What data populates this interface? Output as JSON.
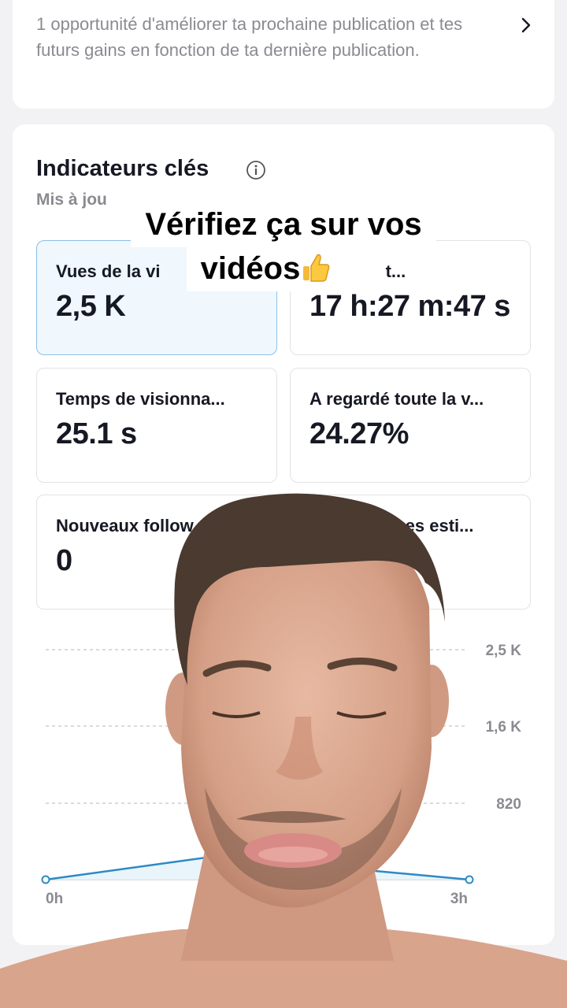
{
  "opportunity": {
    "text": "1 opportunité d'améliorer ta prochaine publication et tes futurs gains en fonction de ta dernière publication.",
    "chevron_icon": "chevron-right-icon"
  },
  "metrics": {
    "title": "Indicateurs clés",
    "info_icon": "info-icon",
    "subtitle": "Mis à jou",
    "tiles": [
      {
        "label": "Vues de la vi",
        "value": "2,5 K",
        "active": true
      },
      {
        "label": "e lecture t...",
        "value": "17 h:27 m:47 s"
      },
      {
        "label": "Temps de visionna...",
        "value": "25.1 s"
      },
      {
        "label": "A regardé toute la v...",
        "value": "24.27%"
      },
      {
        "label": "Nouveaux follow",
        "value": "0"
      },
      {
        "label": "nses esti...",
        "value": ""
      }
    ]
  },
  "chart_data": {
    "type": "line",
    "x_tick_labels": [
      "0h",
      "3h"
    ],
    "y_tick_labels": [
      "2,5 K",
      "1,6 K",
      "820"
    ],
    "ylim": [
      0,
      2460
    ],
    "grid": true,
    "series": [
      {
        "points": [
          [
            0,
            0
          ],
          [
            1.2,
            250
          ],
          [
            3,
            0
          ]
        ]
      }
    ],
    "colors": {
      "line": "#2d8ac4",
      "fill": "#e8f3fb"
    }
  },
  "overlay": {
    "caption_line1": "Vérifiez ça sur vos",
    "caption_line2": "vidéos",
    "emojis": [
      "thumbs-up-icon",
      "check-mark-icon"
    ]
  }
}
